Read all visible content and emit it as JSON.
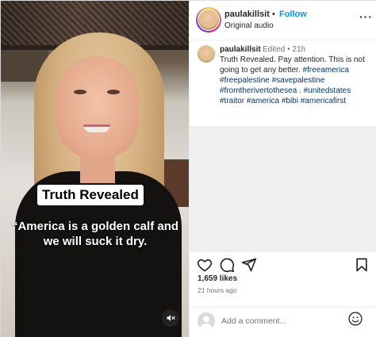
{
  "video": {
    "title_caption": "Truth Revealed",
    "quote_caption": "“America is a golden calf and we will suck it dry.",
    "mute_icon": "speaker-muted-icon"
  },
  "header": {
    "username": "paulakillsit",
    "separator": "•",
    "follow_label": "Follow",
    "audio_label": "Original audio",
    "more_label": "···"
  },
  "caption": {
    "username": "paulakillsit",
    "edited": "Edited • 21h",
    "text": "Truth Revealed. Pay attention. This is not going to get any better.",
    "hashtags": [
      "#freeamerica",
      "#freepalestine",
      "#savepalestine",
      "#fromtherivertothesea",
      ".",
      "#unitedstates",
      "#traitor",
      "#america",
      "#bibi",
      "#americafirst"
    ]
  },
  "actions": {
    "icons": [
      "heart-icon",
      "comment-icon",
      "share-icon",
      "bookmark-icon"
    ],
    "likes": "1,659 likes",
    "time_ago": "21 hours ago"
  },
  "comment": {
    "placeholder": "Add a comment...",
    "emoji_icon": "emoji-icon"
  },
  "colors": {
    "link_blue": "#0095f6",
    "hashtag": "#00376b",
    "text": "#262626",
    "muted": "#737373"
  }
}
